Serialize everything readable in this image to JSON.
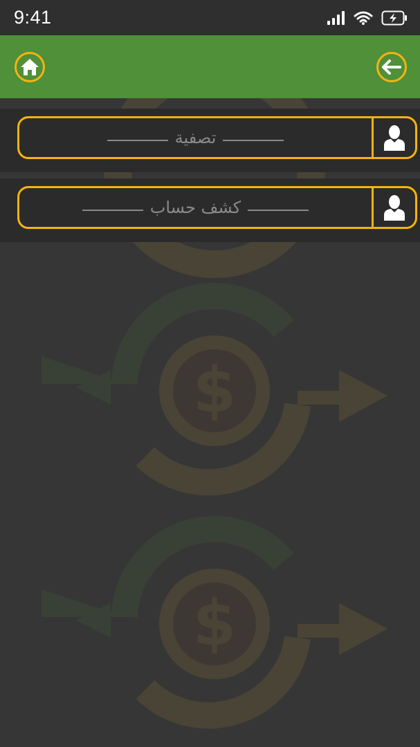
{
  "status": {
    "time": "9:41",
    "icons": [
      "signal-icon",
      "wifi-icon",
      "battery-charging-icon"
    ]
  },
  "header": {
    "home_icon": "home-icon",
    "back_icon": "arrow-left-icon"
  },
  "menu": {
    "items": [
      {
        "label": "تصفية",
        "icon": "user-icon"
      },
      {
        "label": "كشف حساب",
        "icon": "user-icon"
      }
    ]
  },
  "colors": {
    "accent": "#f5b40f",
    "header": "#4f9039",
    "background": "#363636",
    "row": "#2b2b2b",
    "muted_text": "#8a8a8a"
  }
}
